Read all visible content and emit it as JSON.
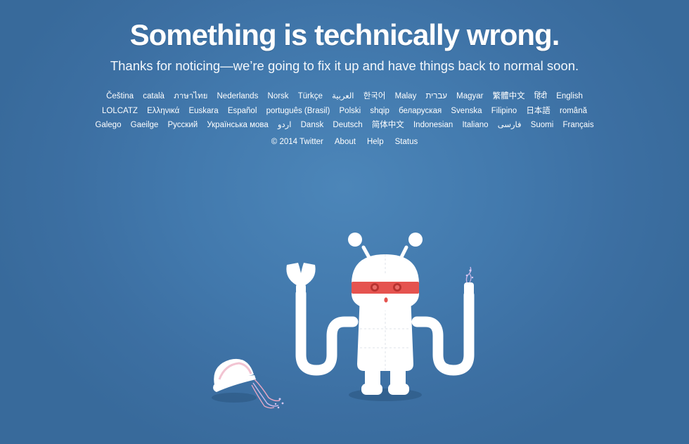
{
  "headline": "Something is technically wrong.",
  "subline": "Thanks for noticing—we’re going to fix it up and have things back to normal soon.",
  "languages": {
    "row1": [
      "Čeština",
      "català",
      "ภาษาไทย",
      "Nederlands",
      "Norsk",
      "Türkçe",
      "العربية",
      "한국어",
      "Malay",
      "עברית",
      "Magyar",
      "繁體中文",
      "हिंदी",
      "English"
    ],
    "row2": [
      "LOLCATZ",
      "Ελληνικά",
      "Euskara",
      "Español",
      "português (Brasil)",
      "Polski",
      "shqip",
      "беларуская",
      "Svenska",
      "Filipino",
      "日本語",
      "română"
    ],
    "row3": [
      "Galego",
      "Gaeilge",
      "Русский",
      "Українська мова",
      "اردو",
      "Dansk",
      "Deutsch",
      "简体中文",
      "Indonesian",
      "Italiano",
      "فارسی",
      "Suomi",
      "Français"
    ]
  },
  "footer": {
    "copyright": "© 2014 Twitter",
    "about": "About",
    "help": "Help",
    "status": "Status"
  },
  "illustration": "robot-with-scissors-and-cut-cable",
  "colors": {
    "background": "#4279ad",
    "robot_body": "#ffffff",
    "visor": "#e5534f",
    "shadow": "#2f5c88"
  }
}
